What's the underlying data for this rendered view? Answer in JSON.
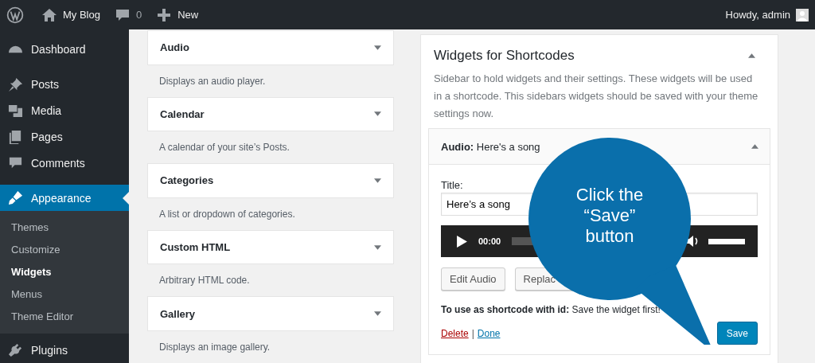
{
  "admin_bar": {
    "site": "My Blog",
    "comments": "0",
    "new": "New",
    "greeting": "Howdy, admin"
  },
  "sidebar": {
    "items": [
      {
        "label": "Dashboard",
        "selected": false
      },
      {
        "label": "Posts",
        "selected": false
      },
      {
        "label": "Media",
        "selected": false
      },
      {
        "label": "Pages",
        "selected": false
      },
      {
        "label": "Comments",
        "selected": false
      },
      {
        "label": "Appearance",
        "selected": true,
        "children": [
          {
            "label": "Themes",
            "selected": false
          },
          {
            "label": "Customize",
            "selected": false
          },
          {
            "label": "Widgets",
            "selected": true
          },
          {
            "label": "Menus",
            "selected": false
          },
          {
            "label": "Theme Editor",
            "selected": false
          }
        ]
      },
      {
        "label": "Plugins",
        "selected": false
      }
    ]
  },
  "available_widgets": [
    {
      "title": "Audio",
      "description": "Displays an audio player."
    },
    {
      "title": "Calendar",
      "description": "A calendar of your site’s Posts."
    },
    {
      "title": "Categories",
      "description": "A list or dropdown of categories."
    },
    {
      "title": "Custom HTML",
      "description": "Arbitrary HTML code."
    },
    {
      "title": "Gallery",
      "description": "Displays an image gallery."
    }
  ],
  "sidebar_area": {
    "title": "Widgets for Shortcodes",
    "description": "Sidebar to hold widgets and their settings. These widgets will be used in a shortcode. This sidebars widgets should be saved with your theme settings now.",
    "widget": {
      "title": "Audio:",
      "subtitle": "Here's a song",
      "field_label": "Title:",
      "field_value": "Here’s a song",
      "player_time": "00:00",
      "buttons": [
        "Edit Audio",
        "Replac"
      ],
      "shortcode_label": "To use as shortcode with id:",
      "shortcode_value": "Save the widget first!",
      "delete": "Delete",
      "separator": "|",
      "done": "Done",
      "save": "Save"
    }
  },
  "callout": {
    "lines": [
      "Click the",
      "“Save”",
      "button"
    ]
  }
}
